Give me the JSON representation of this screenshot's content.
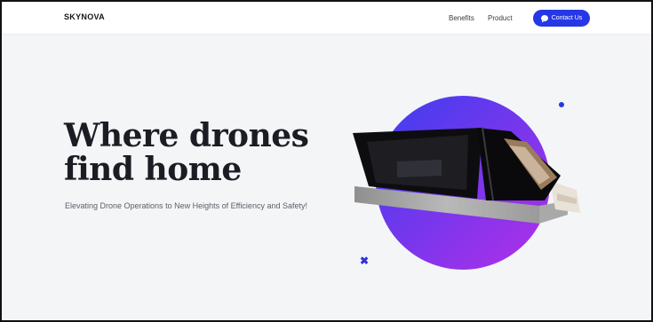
{
  "nav": {
    "logo": "SKYNOVA",
    "links": [
      "Benefits",
      "Product"
    ],
    "contact_label": "Contact Us"
  },
  "hero": {
    "headline_line1": "Where drones",
    "headline_line2": "find home",
    "subtext": "Elevating Drone Operations to New Heights of Efficiency and Safety!"
  },
  "decor": {
    "x_mark": "✖"
  },
  "colors": {
    "accent": "#2638e6",
    "gradient_start": "#3b3ef0",
    "gradient_end": "#b32fe8",
    "page_bg": "#f4f5f7"
  },
  "icons": [
    "chat-icon",
    "drone-hangar-illustration"
  ]
}
